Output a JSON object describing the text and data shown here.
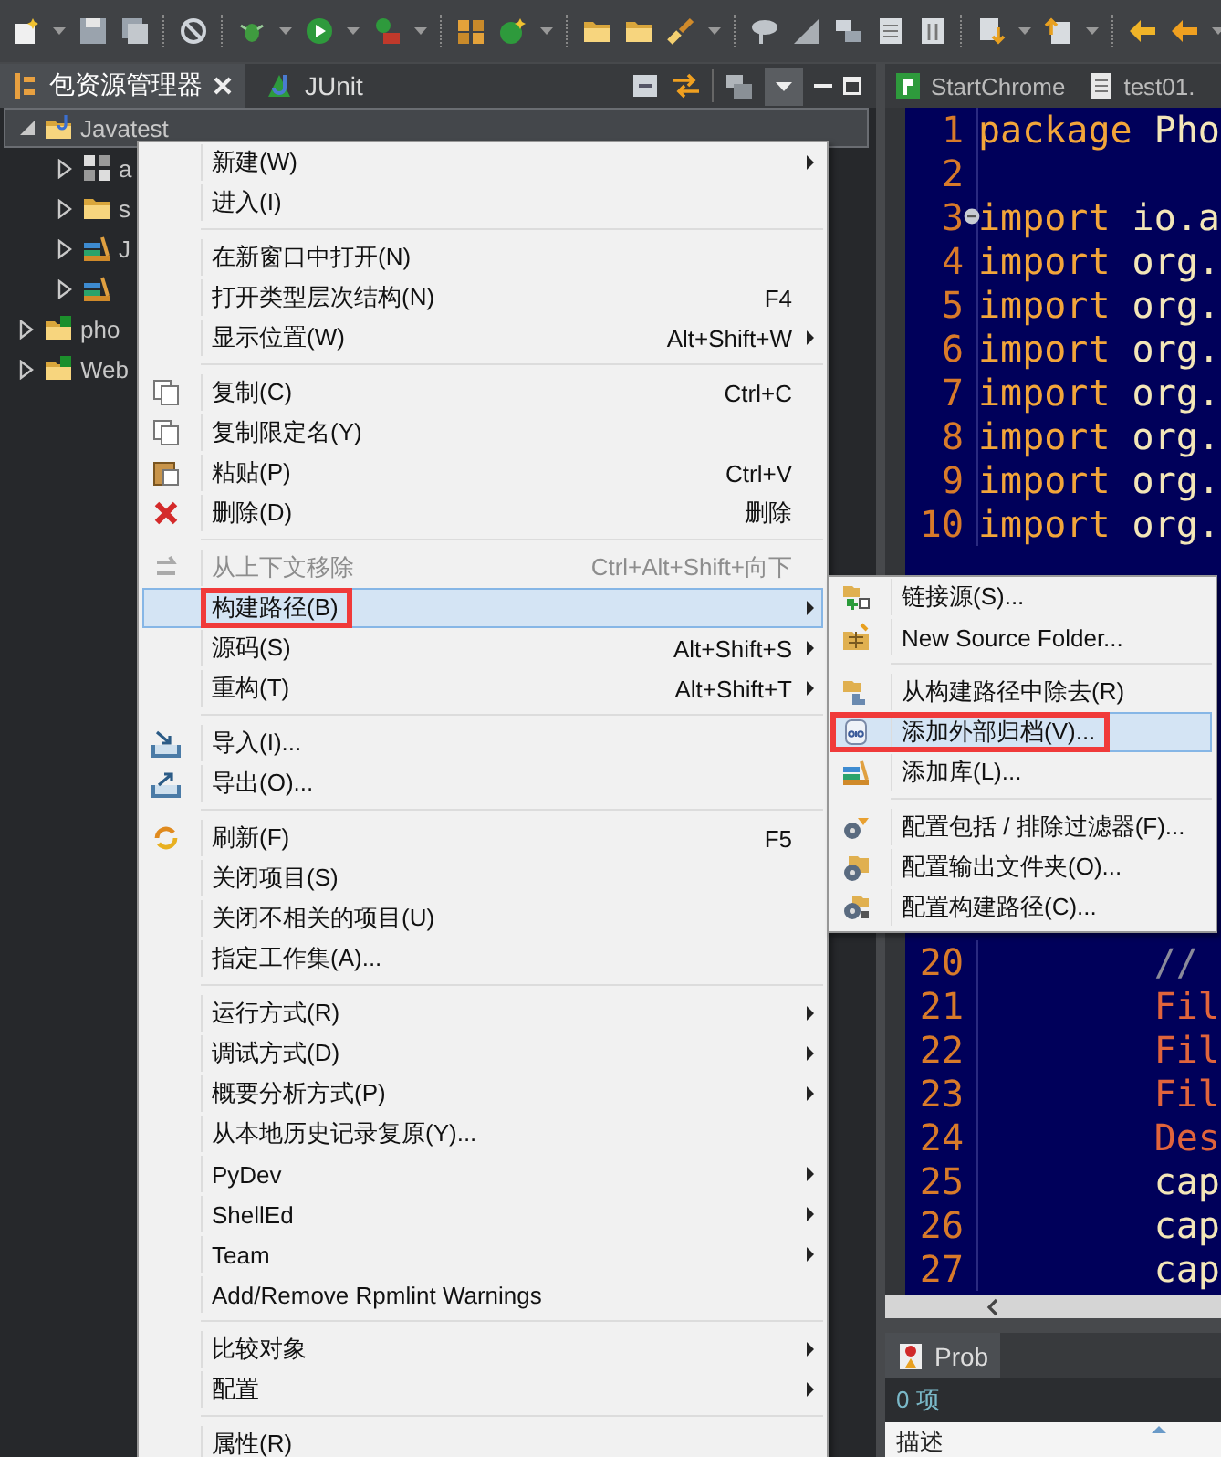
{
  "explorer": {
    "tabs": [
      {
        "label": "包资源管理器",
        "selected": true,
        "closable": true
      },
      {
        "label": "JUnit",
        "selected": false,
        "closable": false
      }
    ],
    "tree": [
      {
        "label": "Javatest",
        "expanded": true,
        "selected": true,
        "children": [
          {
            "label": "a",
            "expanded": false,
            "selected": false
          },
          {
            "label": "s",
            "expanded": false,
            "selected": false
          },
          {
            "label": "J",
            "expanded": false,
            "selected": false
          },
          {
            "expanded": false,
            "selected": false
          }
        ]
      },
      {
        "label": "pho",
        "expanded": false,
        "selected": false
      },
      {
        "label": "Web",
        "expanded": false,
        "selected": false
      }
    ]
  },
  "editor": {
    "tabs": [
      {
        "label": "StartChrome"
      },
      {
        "label": "test01."
      }
    ],
    "lines": [
      {
        "number": "1",
        "fold": false,
        "tokens": [
          {
            "kind": "keyword",
            "text": "package"
          },
          {
            "kind": "plain",
            "text": " Pho"
          }
        ]
      },
      {
        "number": "2",
        "fold": false
      },
      {
        "number": "3",
        "fold": true,
        "tokens": [
          {
            "kind": "keyword",
            "text": "import"
          },
          {
            "kind": "plain",
            "text": " io.a"
          }
        ]
      },
      {
        "number": "4",
        "fold": false,
        "tokens": [
          {
            "kind": "keyword",
            "text": "import"
          },
          {
            "kind": "plain",
            "text": " org."
          }
        ]
      },
      {
        "number": "5",
        "fold": false,
        "tokens": [
          {
            "kind": "keyword",
            "text": "import"
          },
          {
            "kind": "plain",
            "text": " org."
          }
        ]
      },
      {
        "number": "6",
        "fold": false,
        "tokens": [
          {
            "kind": "keyword",
            "text": "import"
          },
          {
            "kind": "plain",
            "text": " org."
          }
        ]
      },
      {
        "number": "7",
        "fold": false,
        "tokens": [
          {
            "kind": "keyword",
            "text": "import"
          },
          {
            "kind": "plain",
            "text": " org."
          }
        ]
      },
      {
        "number": "8",
        "fold": false,
        "tokens": [
          {
            "kind": "keyword",
            "text": "import"
          },
          {
            "kind": "plain",
            "text": " org."
          }
        ]
      },
      {
        "number": "9",
        "fold": false,
        "tokens": [
          {
            "kind": "keyword",
            "text": "import"
          },
          {
            "kind": "plain",
            "text": " org."
          }
        ]
      },
      {
        "number": "10",
        "fold": false,
        "tokens": [
          {
            "kind": "keyword",
            "text": "import"
          },
          {
            "kind": "plain",
            "text": " org."
          }
        ]
      },
      {
        "number": "20",
        "fold": false,
        "tokens": [
          {
            "kind": "comment",
            "text": "        //"
          }
        ]
      },
      {
        "number": "21",
        "fold": false,
        "tokens": [
          {
            "kind": "type",
            "text": "        Fil"
          }
        ]
      },
      {
        "number": "22",
        "fold": false,
        "tokens": [
          {
            "kind": "type",
            "text": "        Fil"
          }
        ]
      },
      {
        "number": "23",
        "fold": false,
        "tokens": [
          {
            "kind": "type",
            "text": "        Fil"
          }
        ]
      },
      {
        "number": "24",
        "fold": false,
        "tokens": [
          {
            "kind": "type",
            "text": "        Des"
          }
        ]
      },
      {
        "number": "25",
        "fold": false,
        "tokens": [
          {
            "kind": "plain",
            "text": "        cap"
          }
        ]
      },
      {
        "number": "26",
        "fold": false,
        "tokens": [
          {
            "kind": "plain",
            "text": "        cap"
          }
        ]
      },
      {
        "number": "27",
        "fold": false,
        "tokens": [
          {
            "kind": "plain",
            "text": "        cap"
          }
        ]
      }
    ]
  },
  "problems": {
    "tab": "Prob",
    "count": "0 项",
    "columns": [
      "描述"
    ]
  },
  "context_menu": {
    "items": [
      {
        "kind": "item",
        "label": "新建(W)",
        "has_submenu": true,
        "disabled": false,
        "selected": false,
        "annotated": false
      },
      {
        "kind": "item",
        "label": "进入(I)",
        "has_submenu": false,
        "disabled": false,
        "selected": false,
        "annotated": false
      },
      {
        "kind": "separator"
      },
      {
        "kind": "item",
        "label": "在新窗口中打开(N)",
        "has_submenu": false,
        "disabled": false,
        "selected": false,
        "annotated": false
      },
      {
        "kind": "item",
        "label": "打开类型层次结构(N)",
        "shortcut": "F4",
        "has_submenu": false,
        "disabled": false,
        "selected": false,
        "annotated": false
      },
      {
        "kind": "item",
        "label": "显示位置(W)",
        "shortcut": "Alt+Shift+W",
        "has_submenu": true,
        "disabled": false,
        "selected": false,
        "annotated": false
      },
      {
        "kind": "separator"
      },
      {
        "kind": "item",
        "label": "复制(C)",
        "shortcut": "Ctrl+C",
        "has_submenu": false,
        "disabled": false,
        "selected": false,
        "annotated": false
      },
      {
        "kind": "item",
        "label": "复制限定名(Y)",
        "has_submenu": false,
        "disabled": false,
        "selected": false,
        "annotated": false
      },
      {
        "kind": "item",
        "label": "粘贴(P)",
        "shortcut": "Ctrl+V",
        "has_submenu": false,
        "disabled": false,
        "selected": false,
        "annotated": false
      },
      {
        "kind": "item",
        "label": "删除(D)",
        "shortcut": "删除",
        "has_submenu": false,
        "disabled": false,
        "selected": false,
        "annotated": false
      },
      {
        "kind": "separator"
      },
      {
        "kind": "item",
        "label": "从上下文移除",
        "shortcut": "Ctrl+Alt+Shift+向下",
        "has_submenu": false,
        "disabled": true,
        "selected": false,
        "annotated": false
      },
      {
        "kind": "item",
        "label": "构建路径(B)",
        "has_submenu": true,
        "disabled": false,
        "selected": true,
        "annotated": true
      },
      {
        "kind": "item",
        "label": "源码(S)",
        "shortcut": "Alt+Shift+S",
        "has_submenu": true,
        "disabled": false,
        "selected": false,
        "annotated": false
      },
      {
        "kind": "item",
        "label": "重构(T)",
        "shortcut": "Alt+Shift+T",
        "has_submenu": true,
        "disabled": false,
        "selected": false,
        "annotated": false
      },
      {
        "kind": "separator"
      },
      {
        "kind": "item",
        "label": "导入(I)...",
        "has_submenu": false,
        "disabled": false,
        "selected": false,
        "annotated": false
      },
      {
        "kind": "item",
        "label": "导出(O)...",
        "has_submenu": false,
        "disabled": false,
        "selected": false,
        "annotated": false
      },
      {
        "kind": "separator"
      },
      {
        "kind": "item",
        "label": "刷新(F)",
        "shortcut": "F5",
        "has_submenu": false,
        "disabled": false,
        "selected": false,
        "annotated": false
      },
      {
        "kind": "item",
        "label": "关闭项目(S)",
        "has_submenu": false,
        "disabled": false,
        "selected": false,
        "annotated": false
      },
      {
        "kind": "item",
        "label": "关闭不相关的项目(U)",
        "has_submenu": false,
        "disabled": false,
        "selected": false,
        "annotated": false
      },
      {
        "kind": "item",
        "label": "指定工作集(A)...",
        "has_submenu": false,
        "disabled": false,
        "selected": false,
        "annotated": false
      },
      {
        "kind": "separator"
      },
      {
        "kind": "item",
        "label": "运行方式(R)",
        "has_submenu": true,
        "disabled": false,
        "selected": false,
        "annotated": false
      },
      {
        "kind": "item",
        "label": "调试方式(D)",
        "has_submenu": true,
        "disabled": false,
        "selected": false,
        "annotated": false
      },
      {
        "kind": "item",
        "label": "概要分析方式(P)",
        "has_submenu": true,
        "disabled": false,
        "selected": false,
        "annotated": false
      },
      {
        "kind": "item",
        "label": "从本地历史记录复原(Y)...",
        "has_submenu": false,
        "disabled": false,
        "selected": false,
        "annotated": false
      },
      {
        "kind": "item",
        "label": "PyDev",
        "has_submenu": true,
        "disabled": false,
        "selected": false,
        "annotated": false
      },
      {
        "kind": "item",
        "label": "ShellEd",
        "has_submenu": true,
        "disabled": false,
        "selected": false,
        "annotated": false
      },
      {
        "kind": "item",
        "label": "Team",
        "has_submenu": true,
        "disabled": false,
        "selected": false,
        "annotated": false
      },
      {
        "kind": "item",
        "label": "Add/Remove Rpmlint Warnings",
        "has_submenu": false,
        "disabled": false,
        "selected": false,
        "annotated": false
      },
      {
        "kind": "separator"
      },
      {
        "kind": "item",
        "label": "比较对象",
        "has_submenu": true,
        "disabled": false,
        "selected": false,
        "annotated": false
      },
      {
        "kind": "item",
        "label": "配置",
        "has_submenu": true,
        "disabled": false,
        "selected": false,
        "annotated": false
      },
      {
        "kind": "separator"
      },
      {
        "kind": "item",
        "label": "属性(R)",
        "has_submenu": false,
        "disabled": false,
        "selected": false,
        "annotated": false
      }
    ]
  },
  "submenu": {
    "items": [
      {
        "kind": "item",
        "label": "链接源(S)...",
        "selected": false,
        "annotated": false
      },
      {
        "kind": "item",
        "label": "New Source Folder...",
        "selected": false,
        "annotated": false
      },
      {
        "kind": "separator"
      },
      {
        "kind": "item",
        "label": "从构建路径中除去(R)",
        "selected": false,
        "annotated": false
      },
      {
        "kind": "item",
        "label": "添加外部归档(V)...",
        "selected": true,
        "annotated": true
      },
      {
        "kind": "item",
        "label": "添加库(L)...",
        "selected": false,
        "annotated": false
      },
      {
        "kind": "separator"
      },
      {
        "kind": "item",
        "label": "配置包括 / 排除过滤器(F)...",
        "selected": false,
        "annotated": false
      },
      {
        "kind": "item",
        "label": "配置输出文件夹(O)...",
        "selected": false,
        "annotated": false
      },
      {
        "kind": "item",
        "label": "配置构建路径(C)...",
        "selected": false,
        "annotated": false
      }
    ]
  }
}
